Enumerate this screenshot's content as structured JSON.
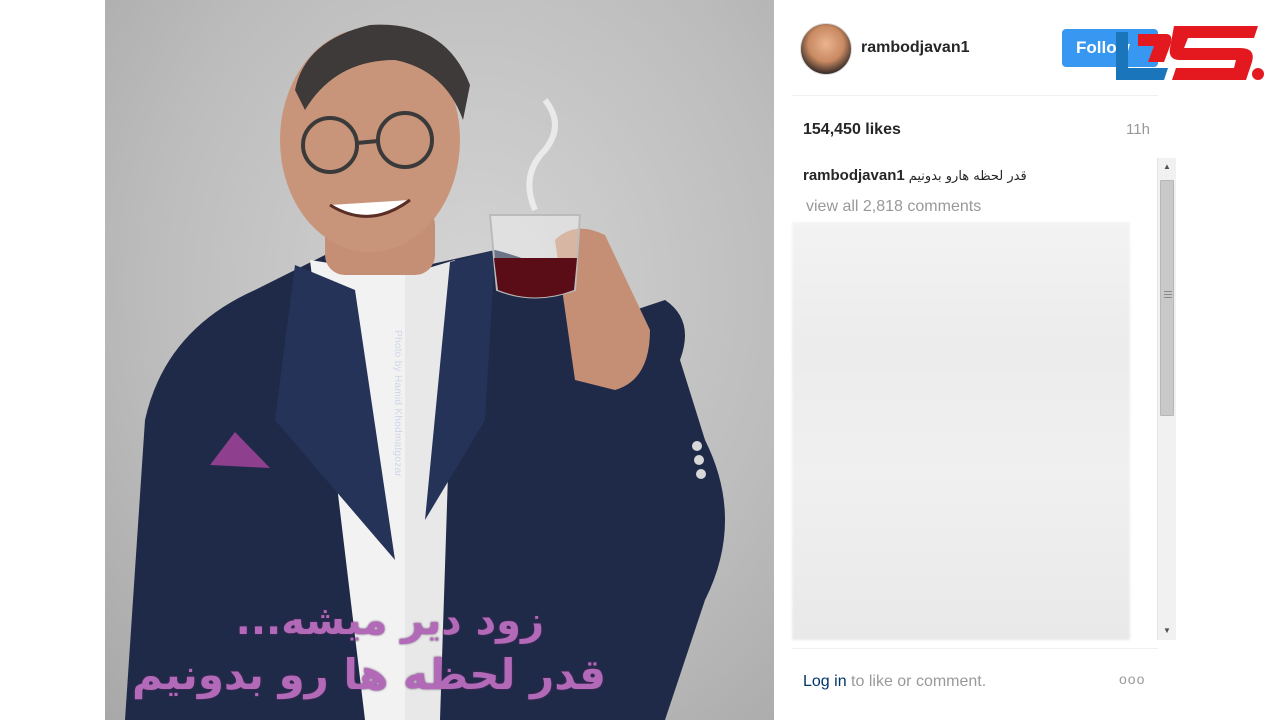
{
  "post": {
    "caption_overlay": {
      "line1": "زود دیر میشه...",
      "line2": "قدر لحظه ها رو بدونیم"
    },
    "photo_credit": "Photo by Hamid Khodmatgozar"
  },
  "header": {
    "username": "rambodjavan1",
    "follow_label": "Follow"
  },
  "stats": {
    "likes": "154,450 likes",
    "time_ago": "11h"
  },
  "comment": {
    "author": "rambodjavan1",
    "text": "قدر لحظه هارو بدونیم"
  },
  "view_all_comments": "view all 2,818 comments",
  "footer": {
    "login_label": "Log in",
    "login_suffix": " to like or comment.",
    "more_label": "ooo"
  },
  "colors": {
    "follow_bg": "#3897f0",
    "logo_red": "#e3191f",
    "logo_blue": "#1b75bb",
    "caption_purple": "#b169b8"
  }
}
